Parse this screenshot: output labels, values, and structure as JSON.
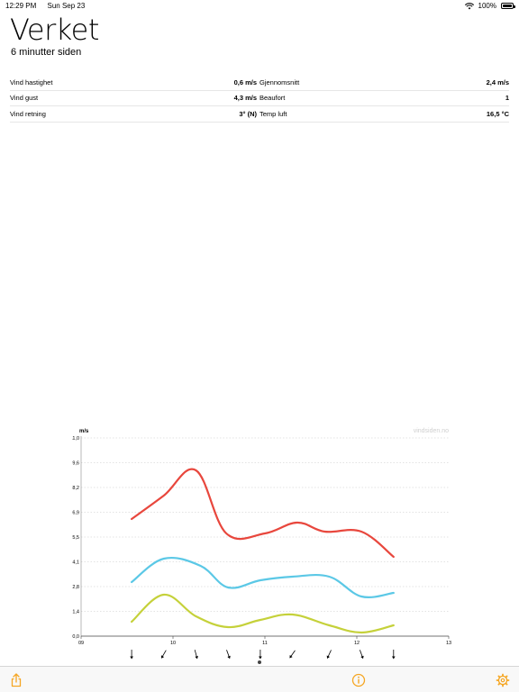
{
  "status_bar": {
    "time": "12:29 PM",
    "date": "Sun Sep 23",
    "battery_percent": "100%"
  },
  "header": {
    "title": "Verket",
    "subtitle": "6 minutter siden"
  },
  "stats": [
    {
      "left_label": "Vind hastighet",
      "left_value": "0,6 m/s",
      "right_label": "Gjennomsnitt",
      "right_value": "2,4 m/s"
    },
    {
      "left_label": "Vind gust",
      "left_value": "4,3 m/s",
      "right_label": "Beaufort",
      "right_value": "1"
    },
    {
      "left_label": "Vind retning",
      "left_value": "3° (N)",
      "right_label": "Temp luft",
      "right_value": "16,5 °C"
    }
  ],
  "chart_data": {
    "type": "line",
    "ylabel": "m/s",
    "watermark": "vindsiden.no",
    "ylim": [
      0,
      11.0
    ],
    "xlim": [
      9,
      13
    ],
    "y_ticks": [
      "0,0",
      "1,4",
      "2,8",
      "4,1",
      "5,5",
      "6,9",
      "8,2",
      "9,6",
      "11,0"
    ],
    "x_ticks": [
      "09",
      "10",
      "11",
      "12",
      "13"
    ],
    "grid": true,
    "series": [
      {
        "color": "#e8473d",
        "x": [
          9.55,
          9.9,
          10.25,
          10.58,
          11.0,
          11.35,
          11.65,
          12.05,
          12.4
        ],
        "y": [
          6.5,
          7.8,
          9.2,
          5.7,
          5.7,
          6.3,
          5.8,
          5.8,
          4.4
        ]
      },
      {
        "color": "#5bc8e6",
        "x": [
          9.55,
          9.9,
          10.3,
          10.6,
          10.95,
          11.3,
          11.7,
          12.05,
          12.4
        ],
        "y": [
          3.0,
          4.3,
          3.9,
          2.7,
          3.1,
          3.3,
          3.3,
          2.2,
          2.4
        ]
      },
      {
        "color": "#c5d13a",
        "x": [
          9.55,
          9.9,
          10.25,
          10.6,
          10.95,
          11.3,
          11.7,
          12.05,
          12.4
        ],
        "y": [
          0.8,
          2.3,
          1.1,
          0.5,
          0.9,
          1.2,
          0.6,
          0.2,
          0.6
        ]
      }
    ],
    "direction_arrows": [
      {
        "x": 9.55,
        "deg": 0
      },
      {
        "x": 9.9,
        "deg": 30
      },
      {
        "x": 10.25,
        "deg": 345
      },
      {
        "x": 10.6,
        "deg": 340
      },
      {
        "x": 10.95,
        "deg": 0
      },
      {
        "x": 11.3,
        "deg": 35
      },
      {
        "x": 11.7,
        "deg": 25
      },
      {
        "x": 12.05,
        "deg": 340
      },
      {
        "x": 12.4,
        "deg": 0
      }
    ]
  },
  "page_indicator": {
    "count": 1,
    "active": 0
  },
  "toolbar": {
    "share_icon": "share-icon",
    "info_icon": "info-icon",
    "settings_icon": "gear-icon",
    "accent": "#f5a623"
  }
}
